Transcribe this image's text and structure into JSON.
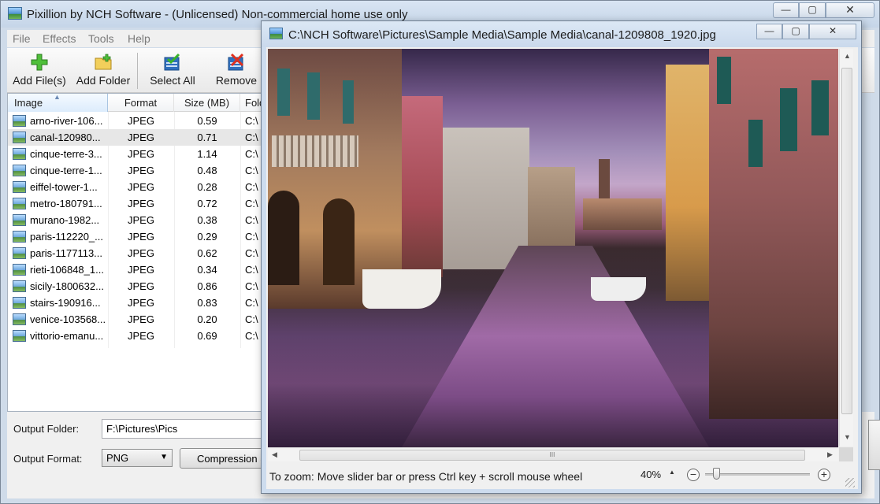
{
  "main_window": {
    "title": "Pixillion by NCH Software - (Unlicensed) Non-commercial home use only",
    "controls": {
      "minimize": "—",
      "maximize": "▢",
      "close": "✕"
    }
  },
  "menu": [
    "File",
    "Effects",
    "Tools",
    "Help"
  ],
  "toolbar": {
    "add_files": "Add File(s)",
    "add_folder": "Add Folder",
    "select_all": "Select All",
    "remove": "Remove"
  },
  "file_list": {
    "columns": {
      "image": "Image",
      "format": "Format",
      "size": "Size (MB)",
      "folder": "Fold"
    },
    "rows": [
      {
        "name": "arno-river-106...",
        "format": "JPEG",
        "size": "0.59",
        "folder": "C:\\"
      },
      {
        "name": "canal-120980...",
        "format": "JPEG",
        "size": "0.71",
        "folder": "C:\\",
        "selected": true
      },
      {
        "name": "cinque-terre-3...",
        "format": "JPEG",
        "size": "1.14",
        "folder": "C:\\"
      },
      {
        "name": "cinque-terre-1...",
        "format": "JPEG",
        "size": "0.48",
        "folder": "C:\\"
      },
      {
        "name": "eiffel-tower-1...",
        "format": "JPEG",
        "size": "0.28",
        "folder": "C:\\"
      },
      {
        "name": "metro-180791...",
        "format": "JPEG",
        "size": "0.72",
        "folder": "C:\\"
      },
      {
        "name": "murano-1982...",
        "format": "JPEG",
        "size": "0.38",
        "folder": "C:\\"
      },
      {
        "name": "paris-112220_...",
        "format": "JPEG",
        "size": "0.29",
        "folder": "C:\\"
      },
      {
        "name": "paris-1177113...",
        "format": "JPEG",
        "size": "0.62",
        "folder": "C:\\"
      },
      {
        "name": "rieti-106848_1...",
        "format": "JPEG",
        "size": "0.34",
        "folder": "C:\\"
      },
      {
        "name": "sicily-1800632...",
        "format": "JPEG",
        "size": "0.86",
        "folder": "C:\\"
      },
      {
        "name": "stairs-190916...",
        "format": "JPEG",
        "size": "0.83",
        "folder": "C:\\"
      },
      {
        "name": "venice-103568...",
        "format": "JPEG",
        "size": "0.20",
        "folder": "C:\\"
      },
      {
        "name": "vittorio-emanu...",
        "format": "JPEG",
        "size": "0.69",
        "folder": "C:\\"
      }
    ]
  },
  "bottom": {
    "output_folder_label": "Output Folder:",
    "output_folder_value": "F:\\Pictures\\Pics",
    "output_format_label": "Output Format:",
    "output_format_value": "PNG",
    "compression_button": "Compression S"
  },
  "preview": {
    "title": "C:\\NCH Software\\Pictures\\Sample Media\\Sample Media\\canal-1209808_1920.jpg",
    "zoom_hint": "To zoom: Move slider bar or press Ctrl key + scroll mouse wheel",
    "zoom_value": "40%",
    "zoom_level": 0.08,
    "zoom_out": "−",
    "zoom_in": "+",
    "hscroll_grip": "III"
  }
}
